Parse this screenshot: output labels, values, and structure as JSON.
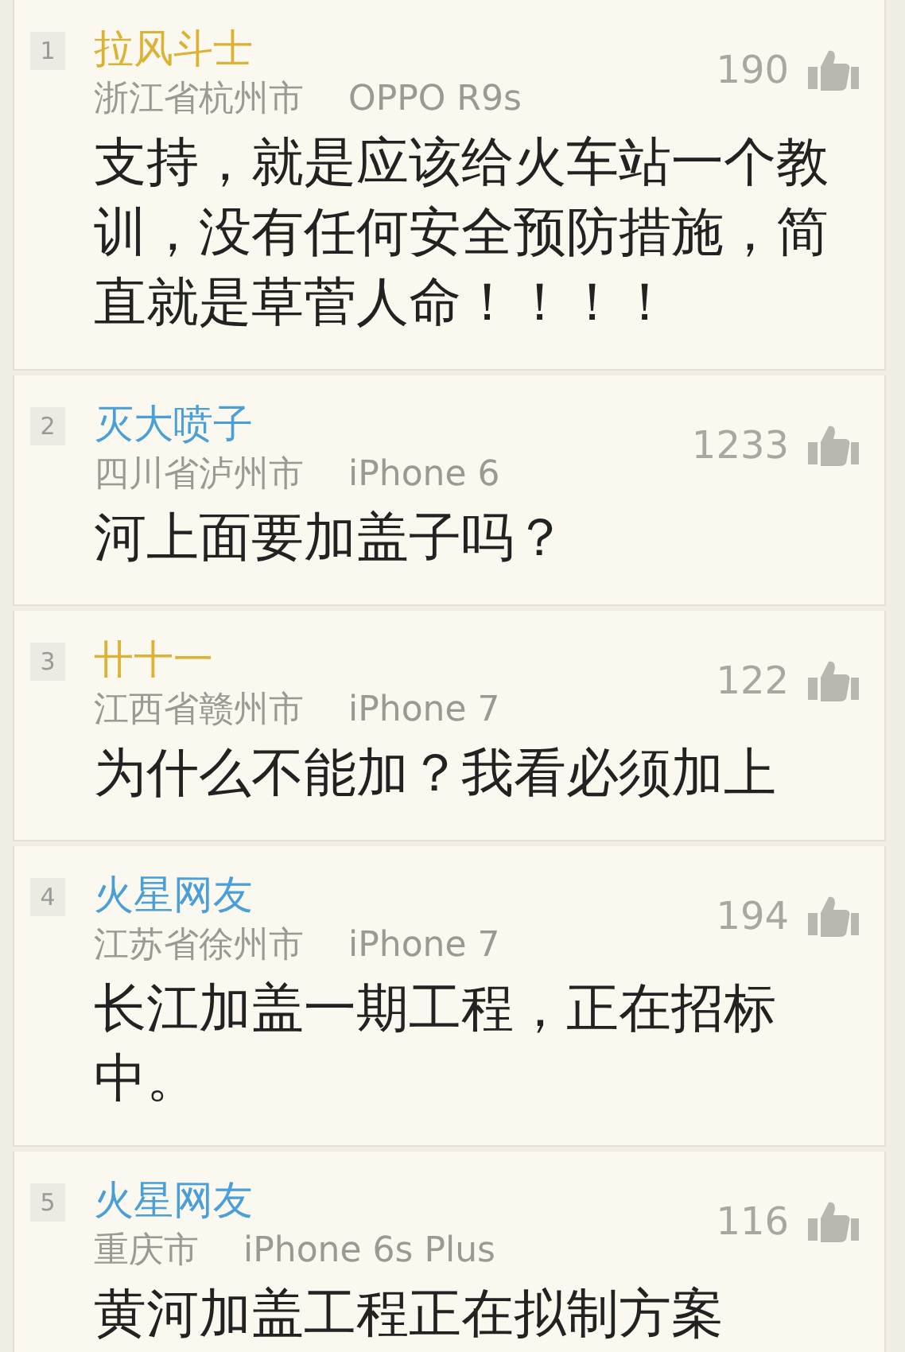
{
  "comments": [
    {
      "rank": "1",
      "user": "拉风斗士",
      "color": "#dcb234",
      "location": "浙江省杭州市",
      "device": "OPPO R9s",
      "likes": "190",
      "text": "支持，就是应该给火车站一个教训，没有任何安全预防措施，简直就是草菅人命！！！！"
    },
    {
      "rank": "2",
      "user": "灭大喷子",
      "color": "#4a9fd6",
      "location": "四川省泸州市",
      "device": "iPhone 6",
      "likes": "1233",
      "text": "河上面要加盖子吗？"
    },
    {
      "rank": "3",
      "user": "卄十一",
      "color": "#dcb234",
      "location": "江西省赣州市",
      "device": "iPhone 7",
      "likes": "122",
      "text": "为什么不能加？我看必须加上"
    },
    {
      "rank": "4",
      "user": "火星网友",
      "color": "#4a9fd6",
      "location": "江苏省徐州市",
      "device": "iPhone 7",
      "likes": "194",
      "text": "长江加盖一期工程，正在招标中。"
    },
    {
      "rank": "5",
      "user": "火星网友",
      "color": "#4a9fd6",
      "location": "重庆市",
      "device": "iPhone 6s Plus",
      "likes": "116",
      "text": "黄河加盖工程正在拟制方案"
    }
  ]
}
